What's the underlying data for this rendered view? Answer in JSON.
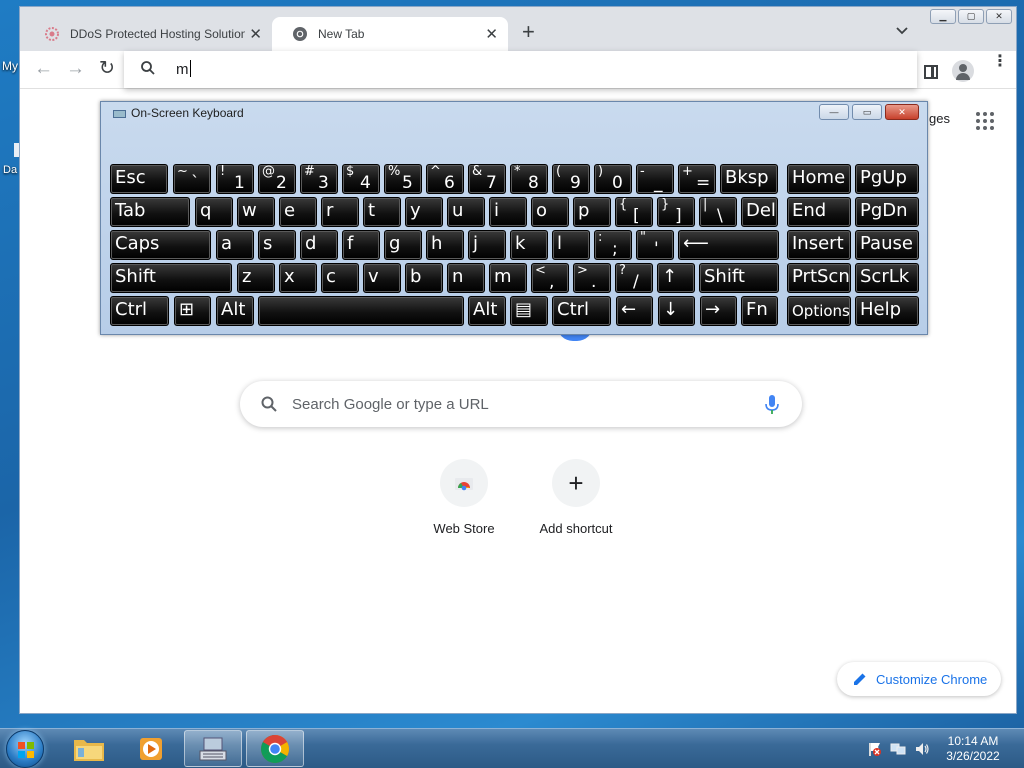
{
  "desktop": {
    "icon_label_fragment_1": "My",
    "icon_label_fragment_2": "Da"
  },
  "browser": {
    "tabs": [
      {
        "title": "DDoS Protected Hosting Solutions",
        "close": "✕"
      },
      {
        "title": "New Tab",
        "close": "✕"
      }
    ],
    "new_tab_glyph": "+",
    "tab_list_glyph": "⌄",
    "omnibox": {
      "value": "m"
    },
    "nav": {
      "back": "←",
      "forward": "→",
      "reload": "↻"
    },
    "menu_glyph": "⋮"
  },
  "ntp": {
    "images_link": "ges",
    "search_placeholder": "Search Google or type a URL",
    "shortcuts": [
      {
        "label": "Web Store"
      },
      {
        "label": "Add shortcut",
        "glyph": "+"
      }
    ],
    "customize_label": "Customize Chrome"
  },
  "osk": {
    "title": "On-Screen Keyboard",
    "controls": {
      "minimize": "—",
      "restore": "▭",
      "close": "✕"
    },
    "keys": [
      {
        "name": "key-esc",
        "label": "Esc"
      },
      {
        "name": "key-backtick",
        "shift": "~",
        "main": "`"
      },
      {
        "name": "key-1",
        "shift": "!",
        "main": "1"
      },
      {
        "name": "key-2",
        "shift": "@",
        "main": "2"
      },
      {
        "name": "key-3",
        "shift": "#",
        "main": "3"
      },
      {
        "name": "key-4",
        "shift": "$",
        "main": "4"
      },
      {
        "name": "key-5",
        "shift": "%",
        "main": "5"
      },
      {
        "name": "key-6",
        "shift": "^",
        "main": "6"
      },
      {
        "name": "key-7",
        "shift": "&",
        "main": "7"
      },
      {
        "name": "key-8",
        "shift": "*",
        "main": "8"
      },
      {
        "name": "key-9",
        "shift": "(",
        "main": "9"
      },
      {
        "name": "key-0",
        "shift": ")",
        "main": "0"
      },
      {
        "name": "key-minus",
        "shift": "-",
        "main": "_"
      },
      {
        "name": "key-equals",
        "shift": "+",
        "main": "="
      },
      {
        "name": "key-bksp",
        "label": "Bksp"
      },
      {
        "name": "key-home",
        "label": "Home"
      },
      {
        "name": "key-pgup",
        "label": "PgUp"
      },
      {
        "name": "key-tab",
        "label": "Tab"
      },
      {
        "name": "key-q",
        "label": "q"
      },
      {
        "name": "key-w",
        "label": "w"
      },
      {
        "name": "key-e",
        "label": "e"
      },
      {
        "name": "key-r",
        "label": "r"
      },
      {
        "name": "key-t",
        "label": "t"
      },
      {
        "name": "key-y",
        "label": "y"
      },
      {
        "name": "key-u",
        "label": "u"
      },
      {
        "name": "key-i",
        "label": "i"
      },
      {
        "name": "key-o",
        "label": "o"
      },
      {
        "name": "key-p",
        "label": "p"
      },
      {
        "name": "key-lbracket",
        "shift": "{",
        "main": "["
      },
      {
        "name": "key-rbracket",
        "shift": "}",
        "main": "]"
      },
      {
        "name": "key-backslash",
        "shift": "|",
        "main": "\\"
      },
      {
        "name": "key-del",
        "label": "Del"
      },
      {
        "name": "key-end",
        "label": "End"
      },
      {
        "name": "key-pgdn",
        "label": "PgDn"
      },
      {
        "name": "key-caps",
        "label": "Caps"
      },
      {
        "name": "key-a",
        "label": "a"
      },
      {
        "name": "key-s",
        "label": "s"
      },
      {
        "name": "key-d",
        "label": "d"
      },
      {
        "name": "key-f",
        "label": "f"
      },
      {
        "name": "key-g",
        "label": "g"
      },
      {
        "name": "key-h",
        "label": "h"
      },
      {
        "name": "key-j",
        "label": "j"
      },
      {
        "name": "key-k",
        "label": "k"
      },
      {
        "name": "key-l",
        "label": "l"
      },
      {
        "name": "key-semicolon",
        "shift": ":",
        "main": ";"
      },
      {
        "name": "key-quote",
        "shift": "\"",
        "main": "'"
      },
      {
        "name": "key-enter",
        "label": "⟵"
      },
      {
        "name": "key-insert",
        "label": "Insert"
      },
      {
        "name": "key-pause",
        "label": "Pause"
      },
      {
        "name": "key-shift-left",
        "label": "Shift"
      },
      {
        "name": "key-z",
        "label": "z"
      },
      {
        "name": "key-x",
        "label": "x"
      },
      {
        "name": "key-c",
        "label": "c"
      },
      {
        "name": "key-v",
        "label": "v"
      },
      {
        "name": "key-b",
        "label": "b"
      },
      {
        "name": "key-n",
        "label": "n"
      },
      {
        "name": "key-m",
        "label": "m"
      },
      {
        "name": "key-comma",
        "shift": "<",
        "main": ","
      },
      {
        "name": "key-period",
        "shift": ">",
        "main": "."
      },
      {
        "name": "key-slash",
        "shift": "?",
        "main": "/"
      },
      {
        "name": "key-up",
        "label": "↑"
      },
      {
        "name": "key-shift-right",
        "label": "Shift"
      },
      {
        "name": "key-prtscn",
        "label": "PrtScn"
      },
      {
        "name": "key-scrlk",
        "label": "ScrLk"
      },
      {
        "name": "key-ctrl-left",
        "label": "Ctrl"
      },
      {
        "name": "key-win",
        "label": "⊞"
      },
      {
        "name": "key-alt-left",
        "label": "Alt"
      },
      {
        "name": "key-space",
        "label": ""
      },
      {
        "name": "key-alt-right",
        "label": "Alt"
      },
      {
        "name": "key-menu",
        "label": "▤"
      },
      {
        "name": "key-ctrl-right",
        "label": "Ctrl"
      },
      {
        "name": "key-left",
        "label": "←"
      },
      {
        "name": "key-down",
        "label": "↓"
      },
      {
        "name": "key-right",
        "label": "→"
      },
      {
        "name": "key-fn",
        "label": "Fn"
      },
      {
        "name": "key-options",
        "label": "Options"
      },
      {
        "name": "key-help",
        "label": "Help"
      }
    ]
  },
  "taskbar": {
    "clock_time": "10:14 AM",
    "clock_date": "3/26/2022"
  },
  "colors": {
    "accent_blue": "#1a73e8",
    "osk_bg": "#c9daee",
    "taskbar": "#3a6a98"
  }
}
